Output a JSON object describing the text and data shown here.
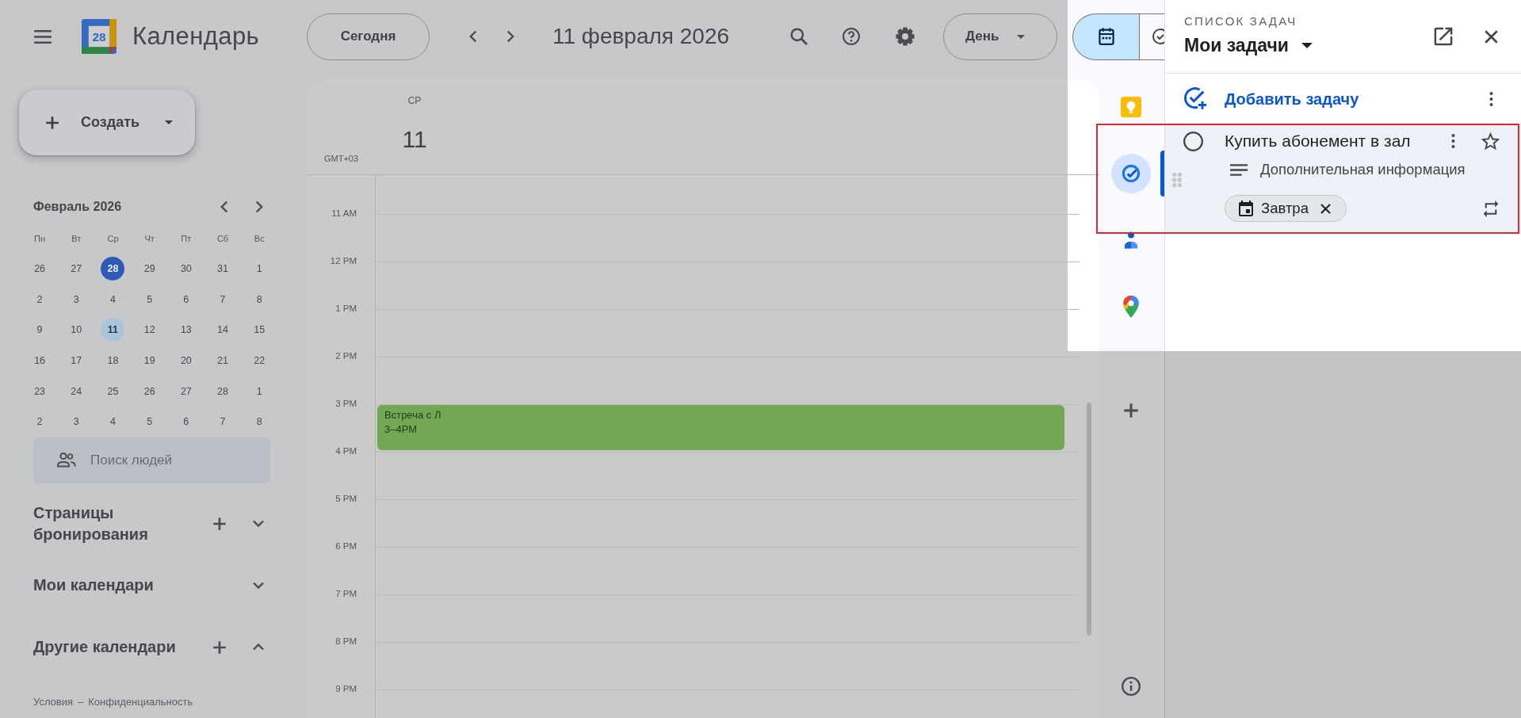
{
  "header": {
    "app_title": "Календарь",
    "logo_date": "28",
    "today_button": "Сегодня",
    "date_title": "11 февраля 2026",
    "view_button": "День",
    "view_toggle": [
      {
        "kind": "calendar",
        "selected": true
      },
      {
        "kind": "tasks",
        "selected": false
      }
    ]
  },
  "sidebar": {
    "create_button": "Создать",
    "mini_calendar": {
      "title": "Февраль 2026",
      "weekdays": [
        "Пн",
        "Вт",
        "Ср",
        "Чт",
        "Пт",
        "Сб",
        "Вс"
      ],
      "weeks": [
        [
          {
            "day": "26",
            "today": false,
            "selected": false
          },
          {
            "day": "27",
            "today": false,
            "selected": false
          },
          {
            "day": "28",
            "today": true,
            "selected": false
          },
          {
            "day": "29",
            "today": false,
            "selected": false
          },
          {
            "day": "30",
            "today": false,
            "selected": false
          },
          {
            "day": "31",
            "today": false,
            "selected": false
          },
          {
            "day": "1",
            "today": false,
            "selected": false
          }
        ],
        [
          {
            "day": "2",
            "today": false,
            "selected": false
          },
          {
            "day": "3",
            "today": false,
            "selected": false
          },
          {
            "day": "4",
            "today": false,
            "selected": false
          },
          {
            "day": "5",
            "today": false,
            "selected": false
          },
          {
            "day": "6",
            "today": false,
            "selected": false
          },
          {
            "day": "7",
            "today": false,
            "selected": false
          },
          {
            "day": "8",
            "today": false,
            "selected": false
          }
        ],
        [
          {
            "day": "9",
            "today": false,
            "selected": false
          },
          {
            "day": "10",
            "today": false,
            "selected": false
          },
          {
            "day": "11",
            "today": false,
            "selected": true
          },
          {
            "day": "12",
            "today": false,
            "selected": false
          },
          {
            "day": "13",
            "today": false,
            "selected": false
          },
          {
            "day": "14",
            "today": false,
            "selected": false
          },
          {
            "day": "15",
            "today": false,
            "selected": false
          }
        ],
        [
          {
            "day": "16",
            "today": false,
            "selected": false
          },
          {
            "day": "17",
            "today": false,
            "selected": false
          },
          {
            "day": "18",
            "today": false,
            "selected": false
          },
          {
            "day": "19",
            "today": false,
            "selected": false
          },
          {
            "day": "20",
            "today": false,
            "selected": false
          },
          {
            "day": "21",
            "today": false,
            "selected": false
          },
          {
            "day": "22",
            "today": false,
            "selected": false
          }
        ],
        [
          {
            "day": "23",
            "today": false,
            "selected": false
          },
          {
            "day": "24",
            "today": false,
            "selected": false
          },
          {
            "day": "25",
            "today": false,
            "selected": false
          },
          {
            "day": "26",
            "today": false,
            "selected": false
          },
          {
            "day": "27",
            "today": false,
            "selected": false
          },
          {
            "day": "28",
            "today": false,
            "selected": false
          },
          {
            "day": "1",
            "today": false,
            "selected": false
          }
        ],
        [
          {
            "day": "2",
            "today": false,
            "selected": false
          },
          {
            "day": "3",
            "today": false,
            "selected": false
          },
          {
            "day": "4",
            "today": false,
            "selected": false
          },
          {
            "day": "5",
            "today": false,
            "selected": false
          },
          {
            "day": "6",
            "today": false,
            "selected": false
          },
          {
            "day": "7",
            "today": false,
            "selected": false
          },
          {
            "day": "8",
            "today": false,
            "selected": false
          }
        ]
      ]
    },
    "people_search": {
      "placeholder": "Поиск людей"
    },
    "sections": [
      {
        "label": "Страницы бронирования",
        "can_add": true,
        "expanded": false
      },
      {
        "label": "Мои календари",
        "can_add": false,
        "expanded": false
      },
      {
        "label": "Другие календари",
        "can_add": true,
        "expanded": true
      }
    ],
    "footer": {
      "links": [
        "Условия",
        "Конфиденциальность"
      ],
      "separator": "–"
    }
  },
  "day_view": {
    "weekday": "СР",
    "day": "11",
    "timezone": "GMT+03",
    "hours": [
      {
        "label": "11 AM"
      },
      {
        "label": "12 PM"
      },
      {
        "label": "1 PM"
      },
      {
        "label": "2 PM"
      },
      {
        "label": "3 PM",
        "events": [
          {
            "title": "Встреча с Л",
            "time": "3–4PM"
          }
        ]
      },
      {
        "label": "4 PM"
      },
      {
        "label": "5 PM"
      },
      {
        "label": "6 PM"
      },
      {
        "label": "7 PM"
      },
      {
        "label": "8 PM"
      },
      {
        "label": "9 PM"
      }
    ]
  },
  "side_panel": {
    "apps": [
      {
        "kind": "keep",
        "selected": false
      },
      {
        "kind": "tasks",
        "selected": true
      },
      {
        "kind": "contacts",
        "selected": false
      },
      {
        "kind": "maps",
        "selected": false
      }
    ]
  },
  "tasks_panel": {
    "caption": "СПИСОК ЗАДАЧ",
    "list_name": "Мои задачи",
    "add_task": "Добавить задачу",
    "tasks": [
      {
        "title": "Купить абонемент в зал",
        "completed": false,
        "starred": false,
        "highlighted": true,
        "details": {
          "placeholder": "Дополнительная информация"
        },
        "due": "Завтра"
      }
    ]
  }
}
